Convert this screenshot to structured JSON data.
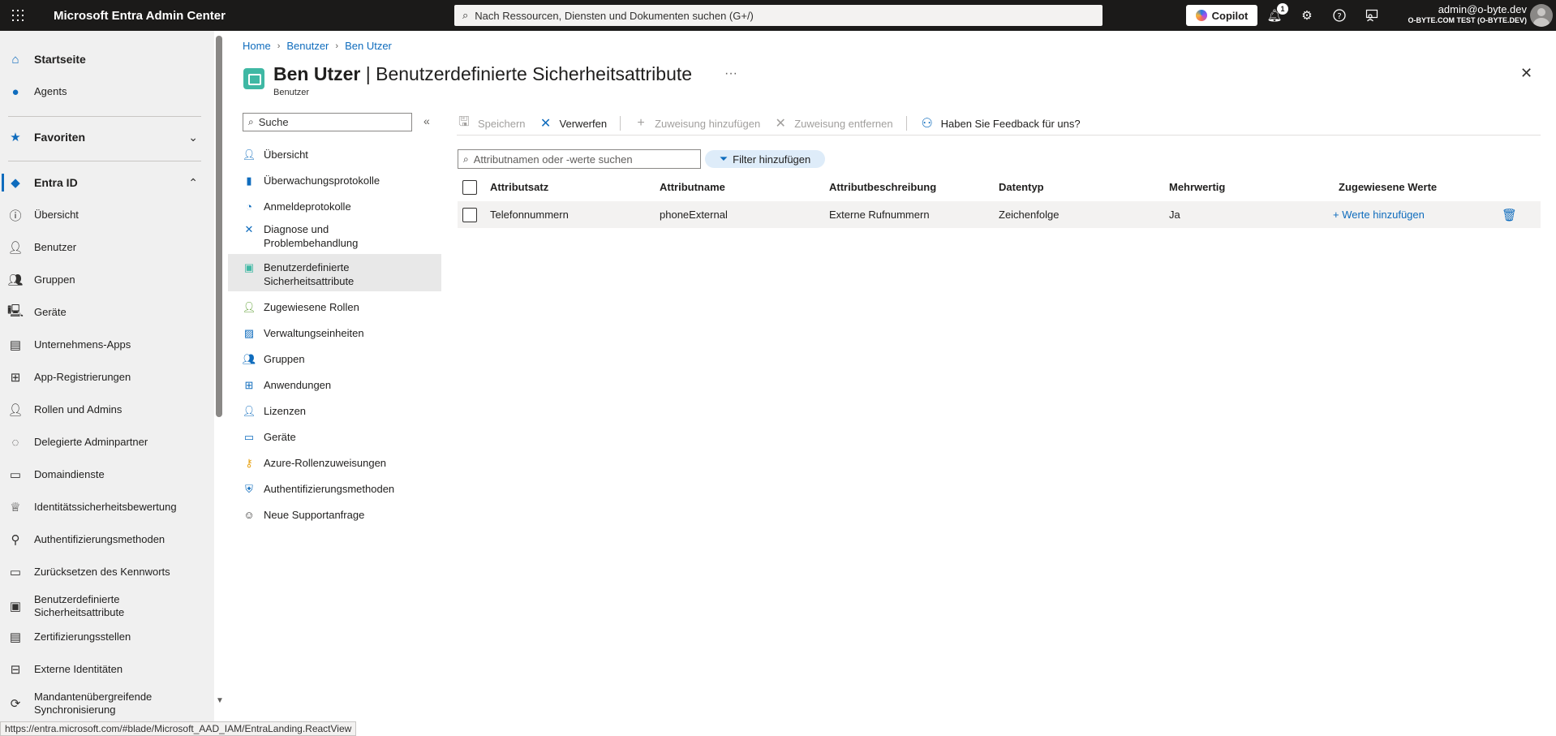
{
  "topbar": {
    "app_title": "Microsoft Entra Admin Center",
    "search_placeholder": "Nach Ressourcen, Diensten und Dokumenten suchen (G+/)",
    "copilot_label": "Copilot",
    "notification_count": "1",
    "user": "admin@o-byte.dev",
    "tenant": "O-BYTE.COM TEST (O-BYTE.DEV)"
  },
  "leftnav": {
    "home": "Startseite",
    "agents": "Agents",
    "favorites": "Favoriten",
    "entra_id": "Entra ID",
    "items": [
      {
        "label": "Übersicht"
      },
      {
        "label": "Benutzer"
      },
      {
        "label": "Gruppen"
      },
      {
        "label": "Geräte"
      },
      {
        "label": "Unternehmens-Apps"
      },
      {
        "label": "App-Registrierungen"
      },
      {
        "label": "Rollen und Admins"
      },
      {
        "label": "Delegierte Adminpartner"
      },
      {
        "label": "Domaindienste"
      },
      {
        "label": "Identitätssicherheitsbewertung"
      },
      {
        "label": "Authentifizierungsmethoden"
      },
      {
        "label": "Zurücksetzen des Kennworts"
      },
      {
        "label": "Benutzerdefinierte Sicherheitsattribute"
      },
      {
        "label": "Zertifizierungsstellen"
      },
      {
        "label": "Externe Identitäten"
      },
      {
        "label": "Mandantenübergreifende Synchronisierung"
      }
    ]
  },
  "breadcrumb": [
    "Home",
    "Benutzer",
    "Ben Utzer"
  ],
  "page": {
    "title_bold": "Ben Utzer",
    "title_rest": " | Benutzerdefinierte Sicherheitsattribute",
    "subtitle": "Benutzer",
    "more": "···"
  },
  "resmenu": {
    "search_placeholder": "Suche",
    "items": [
      {
        "label": "Übersicht"
      },
      {
        "label": "Überwachungsprotokolle"
      },
      {
        "label": "Anmeldeprotokolle"
      },
      {
        "label": "Diagnose und Problembehandlung"
      },
      {
        "label": "Benutzerdefinierte Sicherheitsattribute"
      },
      {
        "label": "Zugewiesene Rollen"
      },
      {
        "label": "Verwaltungseinheiten"
      },
      {
        "label": "Gruppen"
      },
      {
        "label": "Anwendungen"
      },
      {
        "label": "Lizenzen"
      },
      {
        "label": "Geräte"
      },
      {
        "label": "Azure-Rollenzuweisungen"
      },
      {
        "label": "Authentifizierungsmethoden"
      },
      {
        "label": "Neue Supportanfrage"
      }
    ]
  },
  "toolbar": {
    "save": "Speichern",
    "discard": "Verwerfen",
    "add_assignment": "Zuweisung hinzufügen",
    "remove_assignment": "Zuweisung entfernen",
    "feedback": "Haben Sie Feedback für uns?"
  },
  "filter": {
    "placeholder": "Attributnamen oder -werte suchen",
    "add_filter": "Filter hinzufügen"
  },
  "table": {
    "headers": [
      "Attributsatz",
      "Attributname",
      "Attributbeschreibung",
      "Datentyp",
      "Mehrwertig",
      "Zugewiesene Werte"
    ],
    "rows": [
      {
        "set": "Telefonnummern",
        "name": "phoneExternal",
        "description": "Externe Rufnummern",
        "type": "Zeichenfolge",
        "multi": "Ja",
        "values_link": "+ Werte hinzufügen"
      }
    ]
  },
  "statusbar": {
    "url": "https://entra.microsoft.com/#blade/Microsoft_AAD_IAM/EntraLanding.ReactView"
  },
  "colors": {
    "accent": "#0f6cbd",
    "topbar": "#1b1a19",
    "nav_bg": "#f0f0f0"
  }
}
